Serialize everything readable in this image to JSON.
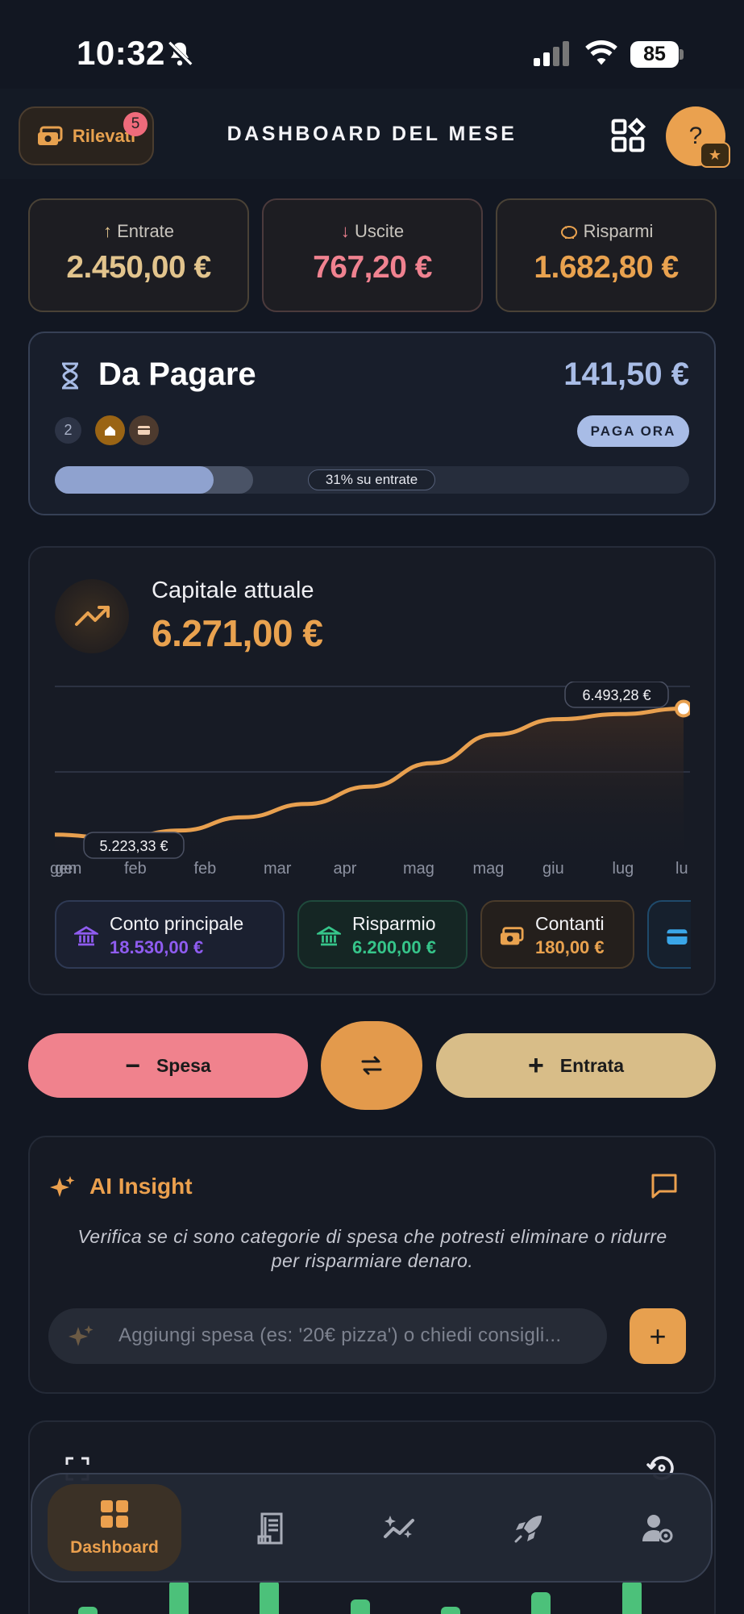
{
  "status_bar": {
    "time": "10:32",
    "battery": "85"
  },
  "header": {
    "detected_label": "Rilevati",
    "detected_count": "5",
    "title": "DASHBOARD DEL MESE",
    "help_label": "?"
  },
  "summary": {
    "income_label": "Entrate",
    "income_value": "2.450,00 €",
    "expense_label": "Uscite",
    "expense_value": "767,20 €",
    "savings_label": "Risparmi",
    "savings_value": "1.682,80 €"
  },
  "to_pay": {
    "title": "Da Pagare",
    "amount": "141,50 €",
    "count": "2",
    "pay_button": "PAGA ORA",
    "progress_label": "31% su entrate",
    "progress_fraction": 0.25
  },
  "capital": {
    "label": "Capitale attuale",
    "value": "6.271,00 €"
  },
  "chart_data": {
    "type": "area",
    "title": "",
    "xlabel": "",
    "ylabel": "",
    "categories": [
      "gen",
      "gen",
      "feb",
      "feb",
      "mar",
      "apr",
      "mag",
      "mag",
      "giu",
      "lug",
      "lu"
    ],
    "values": [
      5260,
      5223.33,
      5300,
      5430,
      5560,
      5730,
      5960,
      6240,
      6390,
      6440,
      6493.28
    ],
    "ylim": [
      5100,
      6600
    ],
    "annotations": [
      {
        "label": "5.223,33 €",
        "value": 5223.33
      },
      {
        "label": "6.493,28 €",
        "value": 6493.28
      }
    ],
    "grid": true,
    "line_color": "#e8a04f"
  },
  "accounts": [
    {
      "name": "Conto principale",
      "value": "18.530,00 €",
      "color": "#8f5cf0",
      "icon": "bank-icon"
    },
    {
      "name": "Risparmio",
      "value": "6.200,00 €",
      "color": "#36c58a",
      "icon": "bank-icon"
    },
    {
      "name": "Contanti",
      "value": "180,00 €",
      "color": "#e9a24f",
      "icon": "cash-icon"
    },
    {
      "name": "",
      "value": "",
      "color": "#3aa6e8",
      "icon": "wallet-icon"
    }
  ],
  "actions": {
    "expense_label": "Spesa",
    "income_label": "Entrata"
  },
  "insight": {
    "title": "AI Insight",
    "text": "Verifica se ci sono categorie di spesa che potresti eliminare o ridurre per risparmiare denaro.",
    "input_placeholder": "Aggiungi spesa (es: '20€ pizza') o chiedi consigli..."
  },
  "bottom_chart": {
    "bar_color": "#4cc17a",
    "bar_levels": [
      0.15,
      0.7,
      0.7,
      0.3,
      0.15,
      0.45,
      0.7
    ]
  },
  "nav": {
    "items": [
      {
        "label": "Dashboard",
        "icon": "dashboard-icon",
        "active": true
      },
      {
        "label": "",
        "icon": "receipt-icon"
      },
      {
        "label": "",
        "icon": "magic-chart-icon"
      },
      {
        "label": "",
        "icon": "rocket-icon"
      },
      {
        "label": "",
        "icon": "user-settings-icon"
      }
    ]
  }
}
